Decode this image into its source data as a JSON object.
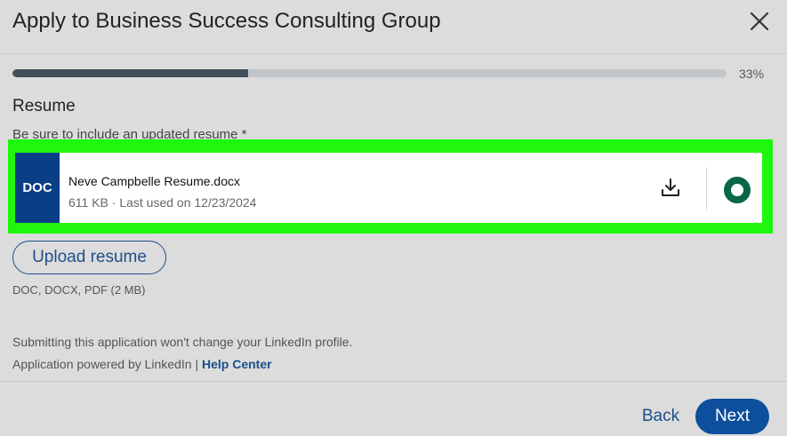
{
  "modal": {
    "title": "Apply to Business Success Consulting Group",
    "close_icon": "close-icon"
  },
  "progress": {
    "percent": 33,
    "label": "33%"
  },
  "resume_section": {
    "title": "Resume",
    "subtitle": "Be sure to include an updated resume *",
    "file": {
      "type_badge": "DOC",
      "name": "Neve Campbelle Resume.docx",
      "meta": "611 KB · Last used on 12/23/2024",
      "download_icon": "download-icon",
      "selected": true
    },
    "upload_label": "Upload resume",
    "file_types": "DOC, DOCX, PDF (2 MB)"
  },
  "footer_text": {
    "notice": "Submitting this application won't change your LinkedIn profile.",
    "powered_by": "Application powered by LinkedIn |",
    "help_link": "Help Center"
  },
  "actions": {
    "back_label": "Back",
    "next_label": "Next"
  },
  "colors": {
    "highlight": "#1df70b",
    "primary": "#0d4f9c",
    "selected_radio": "#086746",
    "doc_badge": "#0a3f87"
  }
}
